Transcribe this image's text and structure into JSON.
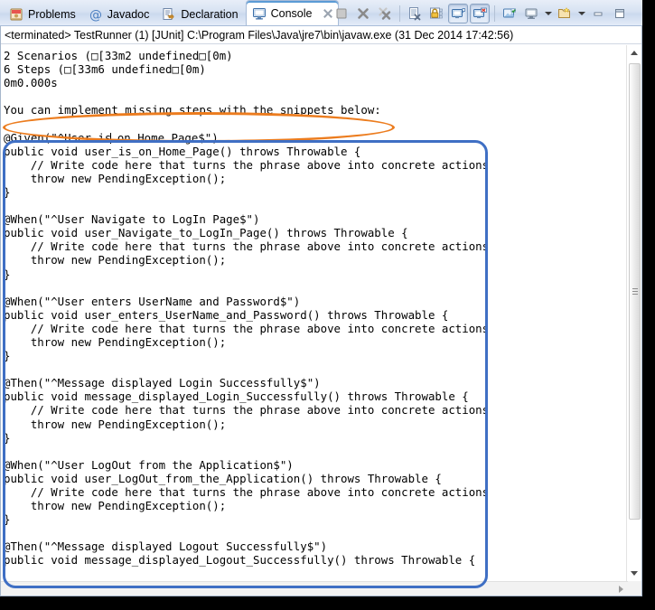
{
  "window": {
    "tabs": [
      {
        "id": "problems",
        "label": "Problems",
        "icon": "problems-icon",
        "active": false,
        "closable": false
      },
      {
        "id": "javadoc",
        "label": "Javadoc",
        "icon": "javadoc-at-icon",
        "active": false,
        "closable": false
      },
      {
        "id": "declaration",
        "label": "Declaration",
        "icon": "declaration-icon",
        "active": false,
        "closable": false
      },
      {
        "id": "console",
        "label": "Console",
        "icon": "console-icon",
        "active": true,
        "closable": true
      }
    ],
    "toolbar": [
      {
        "id": "terminate",
        "icon": "stop-square-icon",
        "pressed": false
      },
      {
        "id": "remove-launch",
        "icon": "remove-launch-x-icon",
        "pressed": false
      },
      {
        "id": "remove-all-launches",
        "icon": "remove-all-launches-x-icon",
        "pressed": false
      },
      {
        "id": "sep1",
        "icon": "separator",
        "pressed": false
      },
      {
        "id": "clear-console",
        "icon": "clear-console-icon",
        "pressed": false
      },
      {
        "id": "scroll-lock",
        "icon": "scroll-lock-padlock-icon",
        "pressed": false
      },
      {
        "id": "show-on-output",
        "icon": "show-console-output-icon",
        "pressed": true
      },
      {
        "id": "show-on-error",
        "icon": "show-console-error-icon",
        "pressed": true
      },
      {
        "id": "sep2",
        "icon": "separator",
        "pressed": false
      },
      {
        "id": "pin-console",
        "icon": "pin-console-icon",
        "pressed": false
      },
      {
        "id": "display-console",
        "icon": "display-selected-console-icon",
        "pressed": false
      },
      {
        "id": "display-menu",
        "icon": "chevron-down-icon",
        "pressed": false
      },
      {
        "id": "open-console",
        "icon": "open-console-icon",
        "pressed": false
      },
      {
        "id": "open-menu",
        "icon": "chevron-down-icon",
        "pressed": false
      },
      {
        "id": "minimize",
        "icon": "minimize-icon",
        "pressed": false
      },
      {
        "id": "maximize",
        "icon": "maximize-icon",
        "pressed": false
      }
    ]
  },
  "console": {
    "status": "<terminated> TestRunner (1) [JUnit] C:\\Program Files\\Java\\jre7\\bin\\javaw.exe (31 Dec 2014 17:42:56)",
    "lines": [
      "2 Scenarios (□[33m2 undefined□[0m)",
      "6 Steps (□[33m6 undefined□[0m)",
      "0m0.000s",
      "",
      "You can implement missing steps with the snippets below:",
      "",
      "@Given(\"^User is| on Home Page$\")",
      "public void user_is_on_Home_Page() throws Throwable {",
      "    // Write code here that turns the phrase above into concrete actions",
      "    throw new PendingException();",
      "}",
      "",
      "@When(\"^User Navigate to LogIn Page$\")",
      "public void user_Navigate_to_LogIn_Page() throws Throwable {",
      "    // Write code here that turns the phrase above into concrete actions",
      "    throw new PendingException();",
      "}",
      "",
      "@When(\"^User enters UserName and Password$\")",
      "public void user_enters_UserName_and_Password() throws Throwable {",
      "    // Write code here that turns the phrase above into concrete actions",
      "    throw new PendingException();",
      "}",
      "",
      "@Then(\"^Message displayed Login Successfully$\")",
      "public void message_displayed_Login_Successfully() throws Throwable {",
      "    // Write code here that turns the phrase above into concrete actions",
      "    throw new PendingException();",
      "}",
      "",
      "@When(\"^User LogOut from the Application$\")",
      "public void user_LogOut_from_the_Application() throws Throwable {",
      "    // Write code here that turns the phrase above into concrete actions",
      "    throw new PendingException();",
      "}",
      "",
      "@Then(\"^Message displayed Logout Successfully$\")",
      "public void message_displayed_Logout_Successfully() throws Throwable {"
    ],
    "caret_line_index": 6,
    "caret_after_text": "@Given(\"^User is"
  },
  "annotations": [
    {
      "id": "highlight-snippets-message",
      "shape": "oval",
      "color": "#ec7c1e"
    },
    {
      "id": "highlight-snippets-block",
      "shape": "rounded-rect",
      "color": "#3f6fc4"
    }
  ],
  "scrollbars": {
    "vertical": {
      "thumb_position": "upper",
      "up_arrow": "scroll-up-icon",
      "down_arrow": "scroll-down-icon"
    },
    "horizontal": {
      "right_arrow": "scroll-right-icon"
    }
  }
}
